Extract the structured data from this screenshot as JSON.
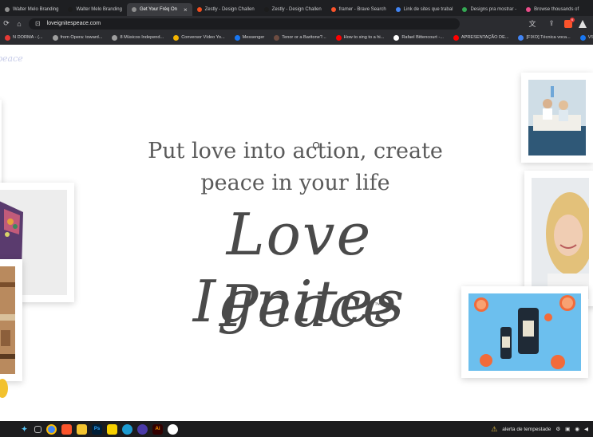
{
  "browser": {
    "tabs": [
      {
        "label": "Walter Melo Branding",
        "color": "#8e8e8e"
      },
      {
        "label": "Walter Melo Branding",
        "color": "#1c1c1c"
      },
      {
        "label": "Get Your Fréq On",
        "color": "#8e8e8e",
        "active": true
      },
      {
        "label": "Zestly - Design Challen",
        "color": "#f24e1e"
      },
      {
        "label": "Zestly - Design Challen",
        "color": "#1c1c1c"
      },
      {
        "label": "framer - Brave Search",
        "color": "#fb542b"
      },
      {
        "label": "Link de sites que trabal",
        "color": "#4285f4"
      },
      {
        "label": "Designs pra mostrar -",
        "color": "#34a853"
      },
      {
        "label": "Browse thousands of",
        "color": "#ea4c89"
      }
    ],
    "url": "loveignitespeace.com",
    "bookmarks": [
      {
        "label": "N DORMA - (...",
        "color": "#e53935"
      },
      {
        "label": "from Opera: toward...",
        "color": "#9e9e9e"
      },
      {
        "label": "8 Músicos Independ...",
        "color": "#9e9e9e"
      },
      {
        "label": "Conversor Vídeo Yo...",
        "color": "#f4b400"
      },
      {
        "label": "Messenger",
        "color": "#1877f2"
      },
      {
        "label": "Tenor or a Baritone?...",
        "color": "#6d4c41"
      },
      {
        "label": "How to sing to a hi...",
        "color": "#ff0000"
      },
      {
        "label": "Rafael Bittencourt -...",
        "color": "#ffffff"
      },
      {
        "label": "APRESENTAÇÃO DE...",
        "color": "#ff0000"
      },
      {
        "label": "[FIXO] Técnica voca...",
        "color": "#4285f4"
      },
      {
        "label": "VS I",
        "color": "#1877f2"
      }
    ]
  },
  "page": {
    "brand": "peace",
    "headline_line1": "Put love into action, create",
    "headline_line2": "peace in your life",
    "script_line1": "Love Ignites",
    "script_line2": "Peace",
    "trademark": "™"
  },
  "taskbar": {
    "weather_text": "alerta de tempestade"
  }
}
